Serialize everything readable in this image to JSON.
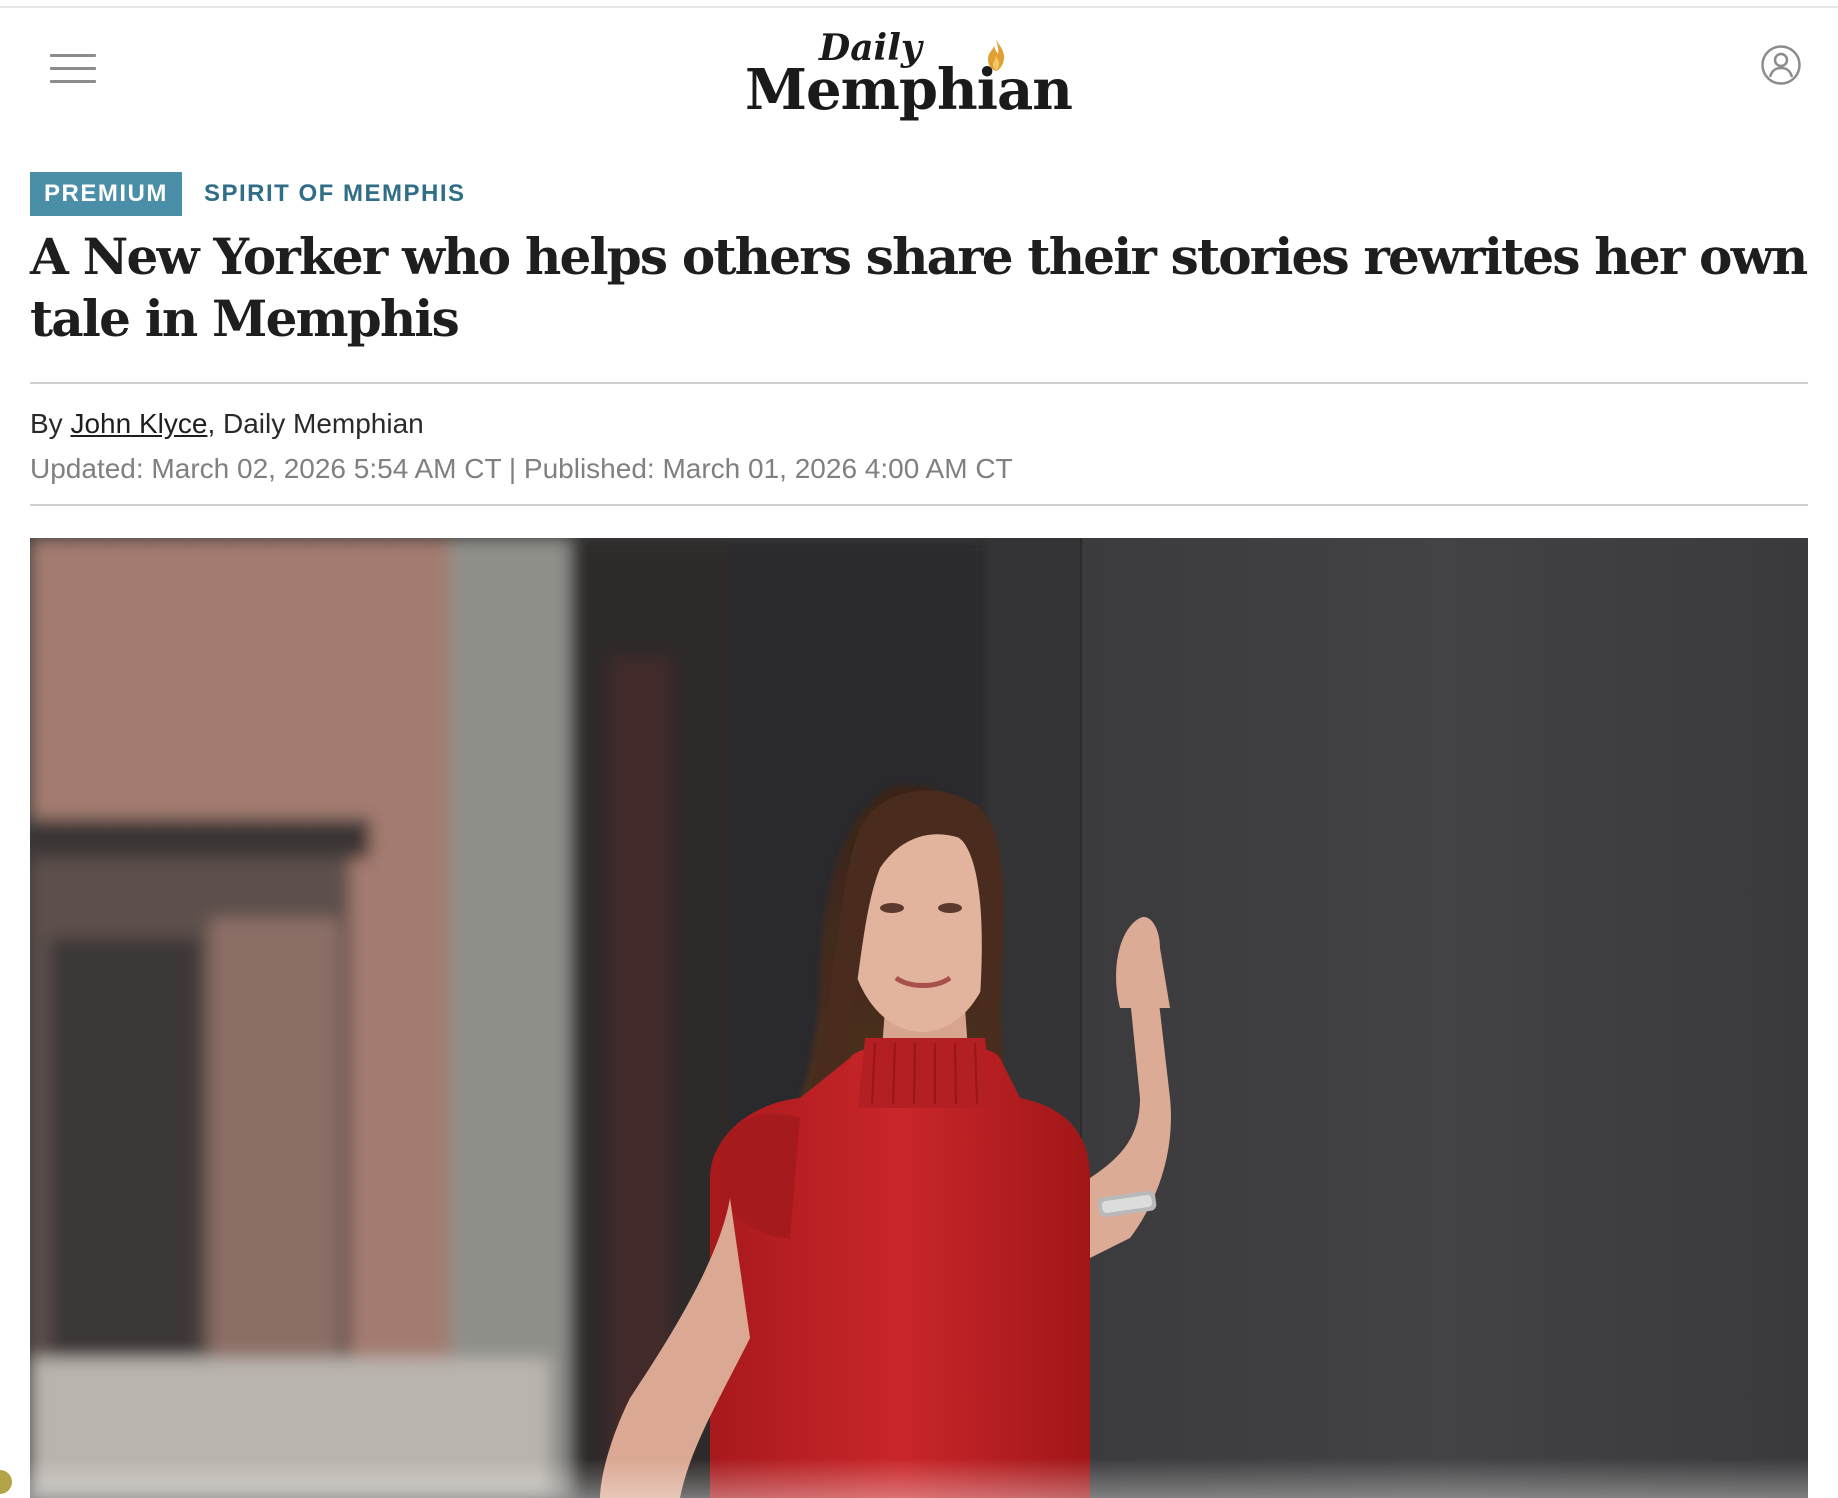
{
  "header": {
    "menu_icon": "hamburger-menu-icon",
    "logo_top": "Daily",
    "logo_main": "Memphian",
    "account_icon": "user-account-icon"
  },
  "article": {
    "badge": "PREMIUM",
    "section": "SPIRIT OF MEMPHIS",
    "headline": "A New Yorker who helps others share their stories rewrites her own tale in Memphis",
    "byline_prefix": "By ",
    "author": "John Klyce",
    "byline_suffix": ", Daily Memphian",
    "dates": "Updated: March 02, 2026 5:54 AM CT | Published: March 01, 2026 4:00 AM CT"
  },
  "colors": {
    "badge_bg": "#4a8ea8",
    "section_text": "#2f6e86",
    "flame": "#e0a032"
  }
}
